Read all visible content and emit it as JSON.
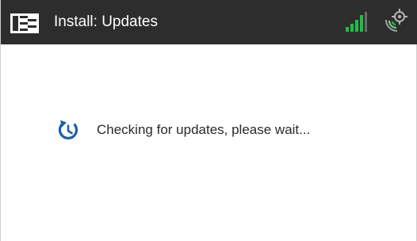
{
  "header": {
    "title": "Install: Updates",
    "app_icon": "app-logo-icon",
    "signal_icon": "signal-strength-icon",
    "gps_icon": "gps-location-icon",
    "signal_color": "#1fbf45",
    "background_color": "#2d2d2d"
  },
  "main": {
    "status_icon": "refresh-icon",
    "status_text": "Checking for updates, please wait...",
    "accent_color": "#1e5fa8"
  }
}
